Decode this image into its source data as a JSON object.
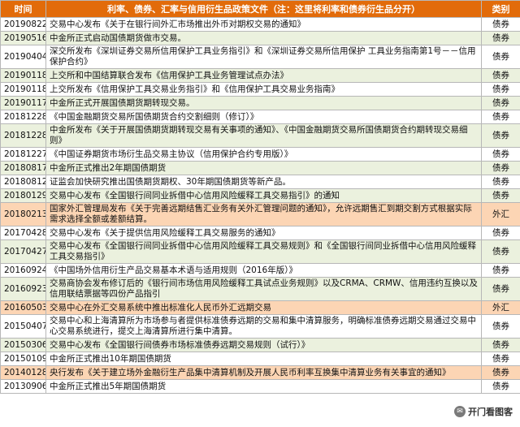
{
  "table": {
    "headers": {
      "date": "时间",
      "content": "利率、债券、汇率与信用衍生品政策文件（注：这里将利率和债券衍生品分开）",
      "type": "类别"
    },
    "rows": [
      {
        "date": "20190822",
        "content": "交易中心发布《关于在银行间外汇市场推出外币对期权交易的通知》",
        "type": "债券",
        "color": "white"
      },
      {
        "date": "20190516",
        "content": "中金所正式启动国债期货做市交易。",
        "type": "债券",
        "color": "green"
      },
      {
        "date": "20190404",
        "content": "深交所发布《深圳证券交易所信用保护工具业务指引》和《深圳证券交易所信用保护 工具业务指南第1号－－信用保护合约》",
        "type": "债券",
        "color": "white"
      },
      {
        "date": "20190118",
        "content": "上交所和中国结算联合发布《信用保护工具业务管理试点办法》",
        "type": "债券",
        "color": "green"
      },
      {
        "date": "20190118",
        "content": "上交所发布《信用保护工具交易业务指引》和《信用保护工具交易业务指南》",
        "type": "债券",
        "color": "white"
      },
      {
        "date": "20190117",
        "content": "中金所正式开展国债期货期转现交易。",
        "type": "债券",
        "color": "green"
      },
      {
        "date": "20181228",
        "content": "《中国金融期货交易所国债期货合约交割细则（修订）》",
        "type": "债券",
        "color": "white"
      },
      {
        "date": "20181228",
        "content": "中金所发布《关于开展国债期货期转现交易有关事项的通知》、《中国金融期货交易所国债期货合约期转现交易细则》",
        "type": "债券",
        "color": "green"
      },
      {
        "date": "20181227",
        "content": "《中国证券期货市场衍生品交易主协议（信用保护合约专用版）》",
        "type": "债券",
        "color": "white"
      },
      {
        "date": "20180817",
        "content": "中金所正式推出2年期国债期货",
        "type": "债券",
        "color": "green"
      },
      {
        "date": "20180812",
        "content": "证监会加快研究推出国债期货期权、30年期国债期货等新产品。",
        "type": "债券",
        "color": "white"
      },
      {
        "date": "20180129",
        "content": "交易中心发布《全国银行间同业拆借中心信用风险缓释工具交易指引》的通知",
        "type": "债券",
        "color": "green"
      },
      {
        "date": "20180213",
        "content": "国家外汇管理局发布《关于完善远期结售汇业务有关外汇管理问题的通知》，允许远期售汇到期交割方式根据实际需求选择全额或差额结算。",
        "type": "外汇",
        "color": "orange"
      },
      {
        "date": "20170428",
        "content": "交易中心发布《关于提供信用风险缓释工具交易服务的通知》",
        "type": "债券",
        "color": "white"
      },
      {
        "date": "20170427",
        "content": "交易中心发布《全国银行间同业拆借中心信用风险缓释工具交易规则》和《全国银行间同业拆借中心信用风险缓释工具交易指引》",
        "type": "债券",
        "color": "green"
      },
      {
        "date": "20160924",
        "content": "《中国场外信用衍生产品交易基本术语与适用规则（2016年版）》",
        "type": "债券",
        "color": "white"
      },
      {
        "date": "20160923",
        "content": "交易商协会发布修订后的《银行间市场信用风险缓释工具试点业务规则》以及CRMA、CRMW、信用违约互换以及信用联结票据等四份产品指引",
        "type": "债券",
        "color": "green"
      },
      {
        "date": "20160503",
        "content": "交易中心在外汇交易系统中推出标准化人民币外汇远期交易",
        "type": "外汇",
        "color": "orange"
      },
      {
        "date": "20150407",
        "content": "交易中心和上海清算所为市场参与者提供标准债券远期的交易和集中清算服务，明确标准债券远期交易通过交易中心交易系统进行，提交上海清算所进行集中清算。",
        "type": "债券",
        "color": "white"
      },
      {
        "date": "20150306",
        "content": "交易中心发布《全国银行间债券市场标准债券远期交易规则（试行）》",
        "type": "债券",
        "color": "green"
      },
      {
        "date": "20150109",
        "content": "中金所正式推出10年期国债期货",
        "type": "债券",
        "color": "white"
      },
      {
        "date": "20140128",
        "content": "央行发布《关于建立场外金融衍生产品集中清算机制及开展人民币利率互换集中清算业务有关事宜的通知》",
        "type": "债券",
        "color": "orange"
      },
      {
        "date": "20130906",
        "content": "中金所正式推出5年期国债期货",
        "type": "债券",
        "color": "white"
      }
    ]
  },
  "watermark": {
    "text": "开门看图客",
    "icon": "chat-bubble-icon"
  }
}
